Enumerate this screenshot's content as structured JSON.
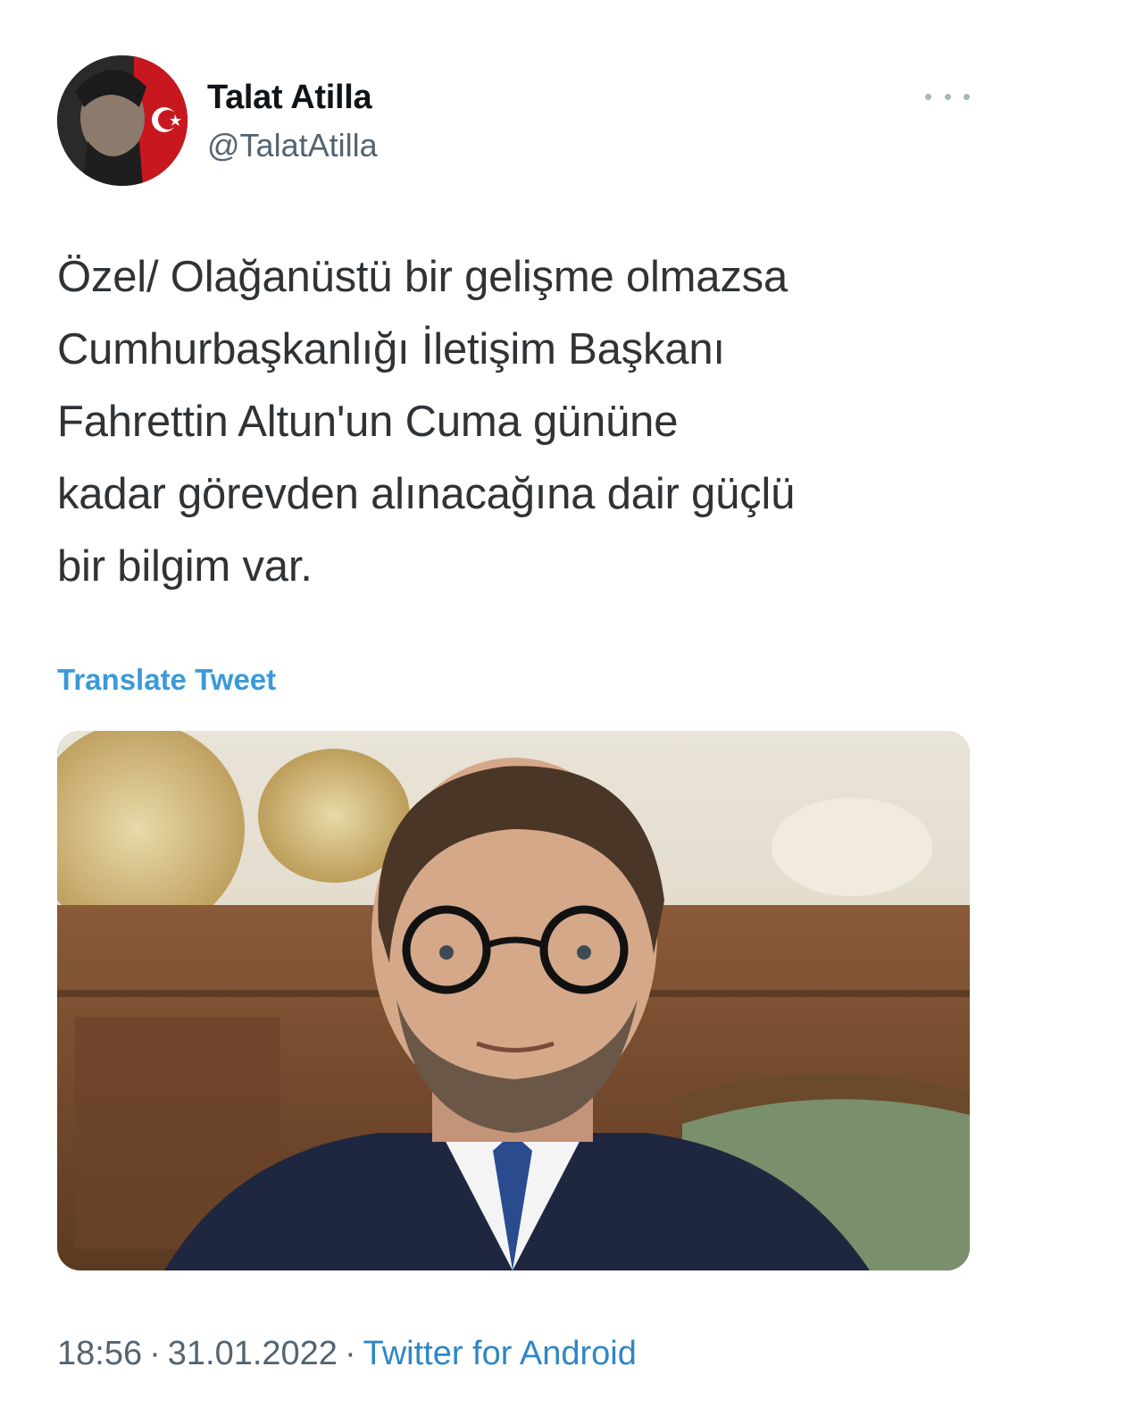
{
  "author": {
    "display_name": "Talat Atilla",
    "handle": "@TalatAtilla"
  },
  "tweet": {
    "text_lines": [
      "Özel/ Olağanüstü bir gelişme olmazsa",
      "Cumhurbaşkanlığı İletişim Başkanı",
      "Fahrettin Altun'un Cuma gününe",
      "kadar görevden alınacağına dair güçlü",
      "bir bilgim var."
    ],
    "translate_label": "Translate Tweet",
    "time": "18:56",
    "date": "31.01.2022",
    "separator": "·",
    "source": "Twitter for Android"
  },
  "icons": {
    "more": "more-horizontal-icon"
  },
  "colors": {
    "link": "#3a9ad9",
    "source_link": "#2f86c5",
    "secondary_text": "#536471"
  }
}
